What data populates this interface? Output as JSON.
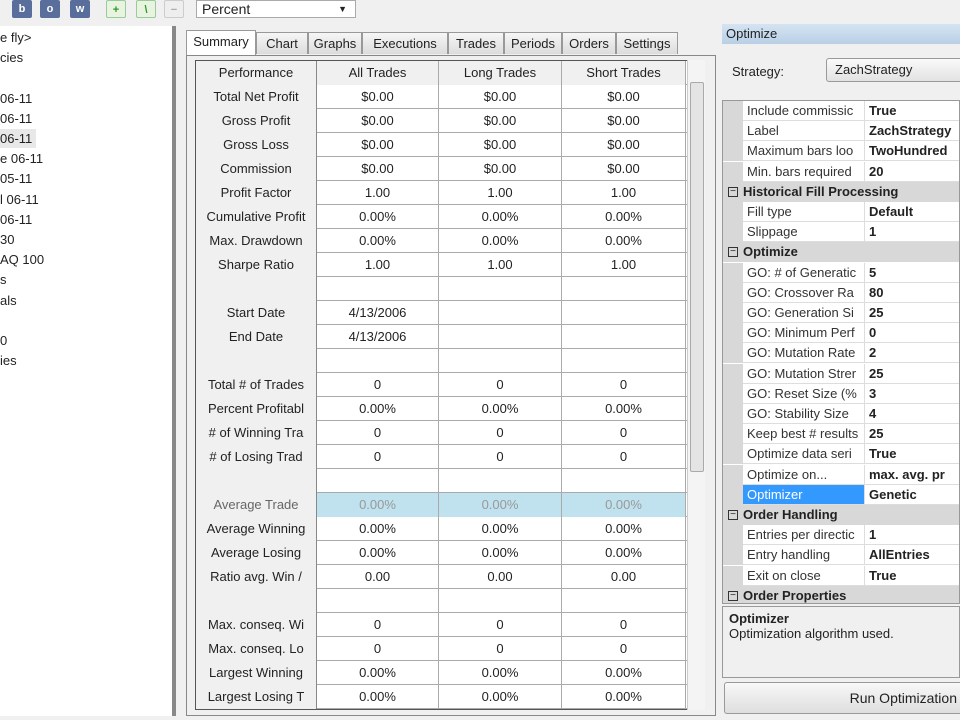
{
  "toolbar": {
    "buttons": [
      "b",
      "o",
      "w"
    ],
    "icons": [
      "add-icon",
      "edit-icon",
      "remove-icon"
    ],
    "combo_value": "Percent"
  },
  "tree": {
    "items": [
      "e fly>",
      "cies",
      "",
      "06-11",
      "06-11",
      "06-11",
      "e 06-11",
      "05-11",
      "l 06-11",
      "06-11",
      "30",
      "AQ 100",
      "s",
      "als",
      "",
      "0",
      "ies"
    ],
    "selected_index": 5
  },
  "tabs": [
    "Summary",
    "Chart",
    "Graphs",
    "Executions",
    "Trades",
    "Periods",
    "Orders",
    "Settings"
  ],
  "grid": {
    "headers": [
      "Performance",
      "All Trades",
      "Long Trades",
      "Short Trades"
    ],
    "selected_row": 17,
    "rows": [
      [
        "Total Net Profit",
        "$0.00",
        "$0.00",
        "$0.00"
      ],
      [
        "Gross Profit",
        "$0.00",
        "$0.00",
        "$0.00"
      ],
      [
        "Gross Loss",
        "$0.00",
        "$0.00",
        "$0.00"
      ],
      [
        "Commission",
        "$0.00",
        "$0.00",
        "$0.00"
      ],
      [
        "Profit Factor",
        "1.00",
        "1.00",
        "1.00"
      ],
      [
        "Cumulative Profit",
        "0.00%",
        "0.00%",
        "0.00%"
      ],
      [
        "Max. Drawdown",
        "0.00%",
        "0.00%",
        "0.00%"
      ],
      [
        "Sharpe Ratio",
        "1.00",
        "1.00",
        "1.00"
      ],
      [
        "",
        "",
        "",
        ""
      ],
      [
        "Start Date",
        "4/13/2006",
        "",
        ""
      ],
      [
        "End Date",
        "4/13/2006",
        "",
        ""
      ],
      [
        "",
        "",
        "",
        ""
      ],
      [
        "Total # of Trades",
        "0",
        "0",
        "0"
      ],
      [
        "Percent Profitabl",
        "0.00%",
        "0.00%",
        "0.00%"
      ],
      [
        "# of Winning Tra",
        "0",
        "0",
        "0"
      ],
      [
        "# of Losing Trad",
        "0",
        "0",
        "0"
      ],
      [
        "",
        "",
        "",
        ""
      ],
      [
        "Average Trade",
        "0.00%",
        "0.00%",
        "0.00%"
      ],
      [
        "Average Winning",
        "0.00%",
        "0.00%",
        "0.00%"
      ],
      [
        "Average Losing",
        "0.00%",
        "0.00%",
        "0.00%"
      ],
      [
        "Ratio avg. Win /",
        "0.00",
        "0.00",
        "0.00"
      ],
      [
        "",
        "",
        "",
        ""
      ],
      [
        "Max. conseq. Wi",
        "0",
        "0",
        "0"
      ],
      [
        "Max. conseq. Lo",
        "0",
        "0",
        "0"
      ],
      [
        "Largest Winning",
        "0.00%",
        "0.00%",
        "0.00%"
      ],
      [
        "Largest Losing T",
        "0.00%",
        "0.00%",
        "0.00%"
      ]
    ]
  },
  "optimize": {
    "title": "Optimize",
    "strategy_label": "Strategy:",
    "strategy_value": "ZachStrategy",
    "properties": [
      {
        "name": "Include commissic",
        "value": "True"
      },
      {
        "name": "Label",
        "value": "ZachStrategy"
      },
      {
        "name": "Maximum bars loo",
        "value": "TwoHundred"
      },
      {
        "name": "Min. bars required",
        "value": "20"
      },
      {
        "category": "Historical Fill Processing"
      },
      {
        "name": "Fill type",
        "value": "Default"
      },
      {
        "name": "Slippage",
        "value": "1"
      },
      {
        "category": "Optimize"
      },
      {
        "name": "GO: # of Generatic",
        "value": "5"
      },
      {
        "name": "GO: Crossover Ra",
        "value": "80"
      },
      {
        "name": "GO: Generation Si",
        "value": "25"
      },
      {
        "name": "GO: Minimum Perf",
        "value": "0"
      },
      {
        "name": "GO: Mutation Rate",
        "value": "2"
      },
      {
        "name": "GO: Mutation Strer",
        "value": "25"
      },
      {
        "name": "GO: Reset Size (%",
        "value": "3"
      },
      {
        "name": "GO: Stability Size",
        "value": "4"
      },
      {
        "name": "Keep best # results",
        "value": "25"
      },
      {
        "name": "Optimize data seri",
        "value": "True"
      },
      {
        "name": "Optimize on...",
        "value": "max. avg. pr"
      },
      {
        "name": "Optimizer",
        "value": "Genetic",
        "selected": true
      },
      {
        "category": "Order Handling"
      },
      {
        "name": "Entries per directic",
        "value": "1"
      },
      {
        "name": "Entry handling",
        "value": "AllEntries"
      },
      {
        "name": "Exit on close",
        "value": "True"
      },
      {
        "category": "Order Properties"
      }
    ],
    "help_title": "Optimizer",
    "help_text": "Optimization algorithm used.",
    "run_button": "Run Optimization"
  }
}
